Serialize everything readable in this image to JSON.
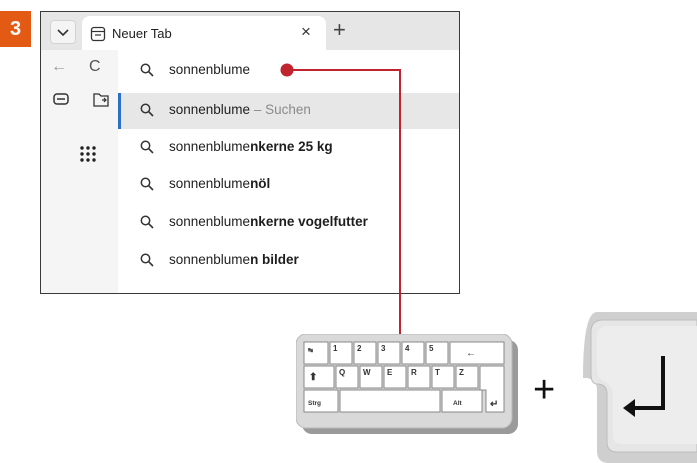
{
  "step": {
    "number": "3"
  },
  "browser": {
    "tab": {
      "title": "Neuer Tab",
      "close_glyph": "×"
    },
    "new_tab_glyph": "+",
    "back_glyph": "←",
    "reload_glyph": "C"
  },
  "address_bar": {
    "query": "sonnenblume"
  },
  "suggestions": [
    {
      "prefix": "sonnenblume",
      "bold": "",
      "suffix": " – Suchen"
    },
    {
      "prefix": "sonnenblume",
      "bold": "nkerne 25 kg",
      "suffix": ""
    },
    {
      "prefix": "sonnenblume",
      "bold": "nöl",
      "suffix": ""
    },
    {
      "prefix": "sonnenblume",
      "bold": "nkerne vogelfutter",
      "suffix": ""
    },
    {
      "prefix": "sonnenblume",
      "bold": "n bilder",
      "suffix": ""
    }
  ],
  "keyboard": {
    "keys": [
      "1",
      "2",
      "3",
      "4",
      "5",
      "Q",
      "W",
      "E",
      "R",
      "T",
      "Z",
      "Strg",
      "Alt"
    ]
  },
  "plus_symbol": "+",
  "colors": {
    "badge": "#e35a14",
    "connector": "#c0242e",
    "selection_bar": "#2b6fc7"
  }
}
